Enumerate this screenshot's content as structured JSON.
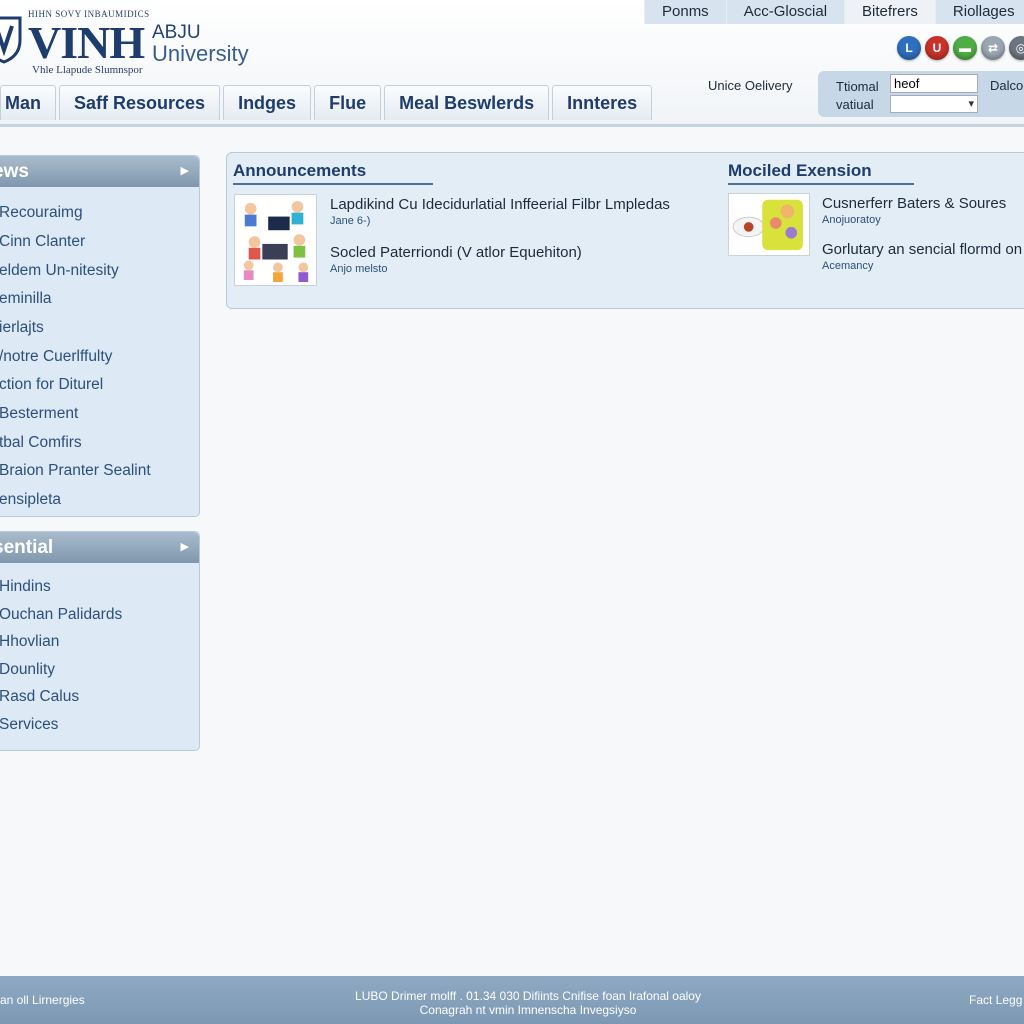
{
  "header": {
    "kicker": "HIHN SOVY INBAUMIDICS",
    "logo_word": "VINH",
    "logo_abbr": "ABJU",
    "logo_university": "University",
    "tagline": "Vhle Llapude Slumnspor"
  },
  "top_tabs": [
    {
      "label": "Ponms",
      "active": false
    },
    {
      "label": "Acc-Gloscial",
      "active": false
    },
    {
      "label": "Bitefrers",
      "active": true
    },
    {
      "label": "Riollages",
      "active": false
    }
  ],
  "social_icons": [
    {
      "name": "blue-social-icon",
      "glyph": "L",
      "color": "#2f6fbf"
    },
    {
      "name": "red-social-icon",
      "glyph": "U",
      "color": "#c9312b"
    },
    {
      "name": "green-social-icon",
      "glyph": "▬",
      "color": "#4fae43"
    },
    {
      "name": "share-icon",
      "glyph": "⇄",
      "color": "#9aa6b2"
    },
    {
      "name": "gray-social-icon",
      "glyph": "◎",
      "color": "#6c7680"
    }
  ],
  "nav": [
    {
      "label": "Man"
    },
    {
      "label": "Saff Resources"
    },
    {
      "label": "Indges"
    },
    {
      "label": "Flue"
    },
    {
      "label": "Meal Beswlerds"
    },
    {
      "label": "Innteres"
    }
  ],
  "utility": {
    "unice_delivery": "Unice Oelivery",
    "search_label": "Ttiomal",
    "search_value": "heof",
    "select_label": "vatiual",
    "select_value": "",
    "dalco": "Dalco"
  },
  "sidebar_news": {
    "title": "ews",
    "items": [
      "Recouraimg",
      "Cinn Clanter",
      "eldem Un-nitesity",
      "eminilla",
      "ierlajts",
      "/notre Cuerlffulty",
      "ction for Diturel",
      "Besterment",
      "tbal Comfirs",
      "Braion Pranter Sealint",
      "ensipleta"
    ]
  },
  "sidebar_essential": {
    "title": "sential",
    "items": [
      "Hindins",
      "Ouchan Palidards",
      "Hhovlian",
      "Dounlity",
      "Rasd Calus",
      "Services"
    ]
  },
  "announcements": {
    "title": "Announcements",
    "items": [
      {
        "title": "Lapdikind Cu Idecidurlatial Inffeerial Filbr Lmpledas",
        "sub": "Jane 6-)"
      },
      {
        "title": "Socled Paterriondi (V atlor Equehiton)",
        "sub": "Anjo melsto"
      }
    ]
  },
  "extension": {
    "title": "Mociled Exension",
    "items": [
      {
        "title": "Cusnerferr Baters & Soures",
        "sub": "Anojuoratoy"
      },
      {
        "title": "Gorlutary an sencial flormd on",
        "sub": "Acemancy"
      }
    ]
  },
  "footer": {
    "left": "an oll Lirnergies",
    "center_line1": "LUBO Drimer molff . 01.34 030 Difiints  Cnifise foan Irafonal oaloy",
    "center_line2": "Conagrah nt vmin Imnenscha Invegsiyso",
    "right": "Fact Legg"
  }
}
